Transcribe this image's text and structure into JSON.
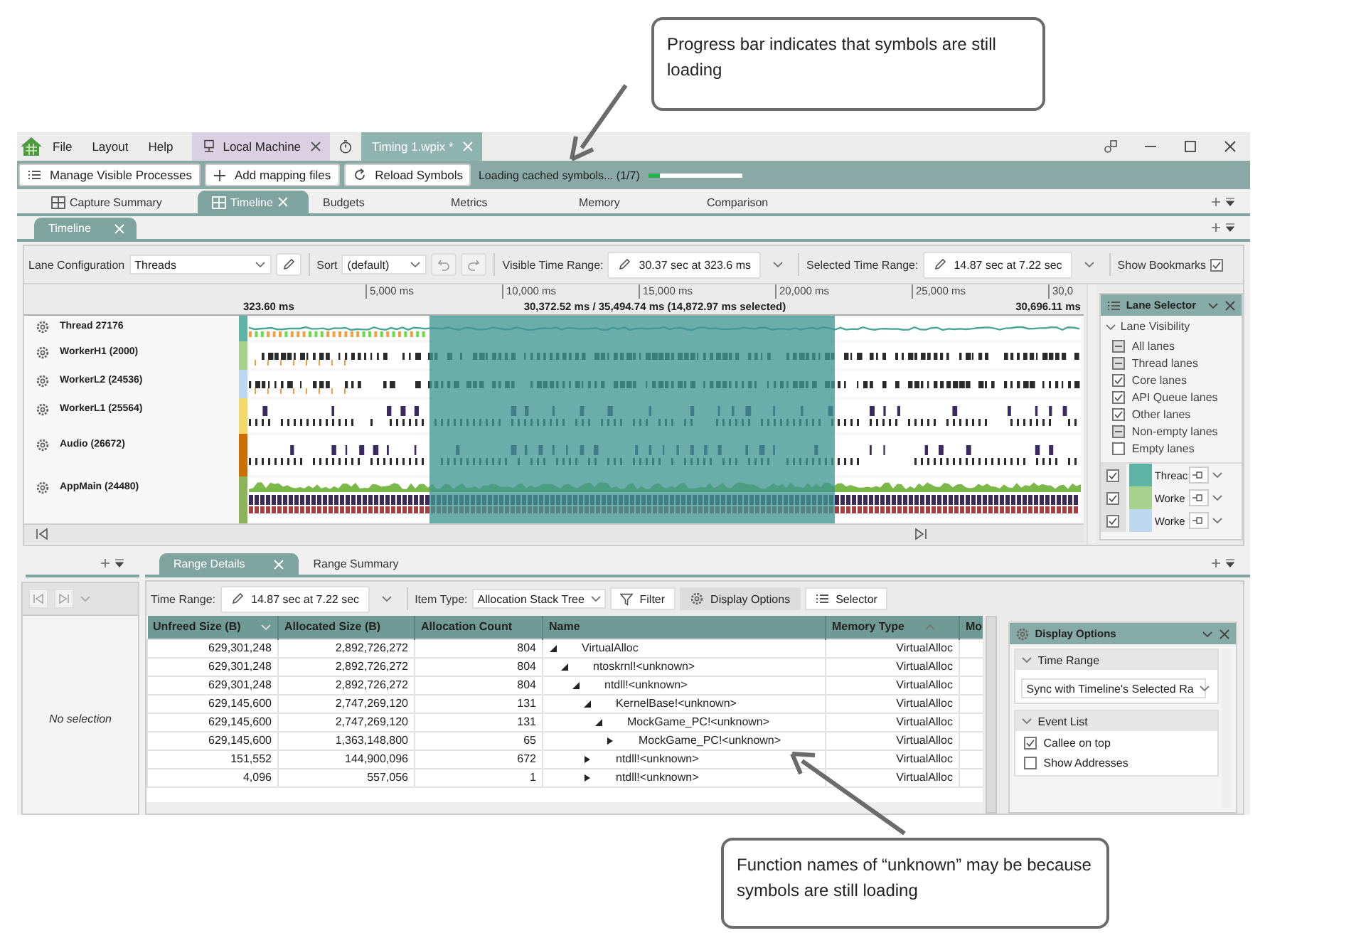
{
  "callouts": [
    {
      "text": "Progress bar indicates that symbols are still loading"
    },
    {
      "text": "Function names of “unknown” may be because symbols are still loading"
    }
  ],
  "menu": [
    "File",
    "Layout",
    "Help"
  ],
  "doc_tabs": [
    {
      "label": "Local Machine",
      "kind": "machine",
      "selected": false
    },
    {
      "label": "Timing 1.wpix *",
      "kind": "capture",
      "selected": true
    }
  ],
  "toolbar": {
    "buttons": [
      {
        "label": "Manage Visible Processes",
        "kind": "list"
      },
      {
        "label": "Add mapping files",
        "kind": "add"
      },
      {
        "label": "Reload Symbols",
        "kind": "reload"
      }
    ],
    "status": "Loading cached symbols... (1/7)",
    "progress": {
      "level": 0.12
    }
  },
  "view_tabs": [
    {
      "label": "Capture Summary",
      "kind": "grid",
      "selected": false
    },
    {
      "label": "Timeline",
      "kind": "grid",
      "selected": true
    },
    {
      "label": "Budgets",
      "kind": "plain",
      "selected": false
    },
    {
      "label": "Metrics",
      "kind": "plain",
      "selected": false
    },
    {
      "label": "Memory",
      "kind": "plain",
      "selected": false
    },
    {
      "label": "Comparison",
      "kind": "plain",
      "selected": false
    }
  ],
  "sub_tabs": [
    {
      "label": "Timeline",
      "selected": true
    }
  ],
  "timeline": {
    "toolbar": {
      "lane_config_label": "Lane Configuration",
      "lane_config": "Threads",
      "sort_label": "Sort",
      "sort": "(default)",
      "visible_label": "Visible Time Range:",
      "visible": "30.37 sec at 323.6 ms",
      "selected_label": "Selected Time Range:",
      "selected": "14.87 sec at 7.22 sec",
      "bookmarks_label": "Show Bookmarks",
      "bookmarks_checked": true
    },
    "ruler": {
      "ticks": [
        "5,000 ms",
        "10,000 ms",
        "15,000 ms",
        "20,000 ms",
        "25,000 ms",
        "30,0"
      ],
      "start": "323.60 ms",
      "center": "30,372.52 ms / 35,494.74 ms (14,872.97 ms selected)",
      "end": "30,696.11 ms"
    },
    "lanes": [
      {
        "name": "Thread 27176",
        "color": "#5fb3a5",
        "kind": "line"
      },
      {
        "name": "WorkerH1 (2000)",
        "color": "#a9d18e",
        "kind": "bars"
      },
      {
        "name": "WorkerL2 (24536)",
        "color": "#bdd7ee",
        "kind": "bars"
      },
      {
        "name": "WorkerL1 (25564)",
        "color": "#f2d96b",
        "kind": "double"
      },
      {
        "name": "Audio (26672)",
        "color": "#cc6e00",
        "kind": "double"
      },
      {
        "name": "AppMain (24480)",
        "color": "#8db35a",
        "kind": "stacked"
      }
    ],
    "lane_selector": {
      "title": "Lane Selector",
      "section": "Lane Visibility",
      "items": [
        {
          "label": "All lanes",
          "checked": false,
          "mixed": true
        },
        {
          "label": "Thread lanes",
          "checked": false,
          "mixed": true
        },
        {
          "label": "Core lanes",
          "checked": true,
          "mixed": false
        },
        {
          "label": "API Queue lanes",
          "checked": true,
          "mixed": false
        },
        {
          "label": "Other lanes",
          "checked": true,
          "mixed": false
        },
        {
          "label": "Non-empty lanes",
          "checked": false,
          "mixed": true
        },
        {
          "label": "Empty lanes",
          "checked": false,
          "mixed": false
        }
      ],
      "lanes": [
        {
          "label": "Threac",
          "color": "#5fb3a5",
          "checked": true
        },
        {
          "label": "Worke",
          "color": "#a9d18e",
          "checked": true
        },
        {
          "label": "Worke",
          "color": "#bdd7ee",
          "checked": true
        }
      ]
    }
  },
  "bottom": {
    "message": "No selection",
    "tabs": [
      {
        "label": "Range Details",
        "selected": true
      },
      {
        "label": "Range Summary",
        "selected": false
      }
    ],
    "toolbar": {
      "time_label": "Time Range:",
      "time": "14.87 sec at 7.22 sec",
      "type_label": "Item Type:",
      "type": "Allocation Stack Tree",
      "buttons": [
        {
          "label": "Filter",
          "kind": "filter",
          "selected": false
        },
        {
          "label": "Display Options",
          "kind": "gear",
          "selected": true
        },
        {
          "label": "Selector",
          "kind": "list",
          "selected": false
        }
      ]
    },
    "table": {
      "columns": [
        {
          "label": "Unfreed Size (B)",
          "sorted_descending": true,
          "sorted_ascending": false
        },
        {
          "label": "Allocated Size (B)",
          "sorted_descending": false,
          "sorted_ascending": false
        },
        {
          "label": "Allocation Count",
          "sorted_descending": false,
          "sorted_ascending": false
        },
        {
          "label": "Name",
          "sorted_descending": false,
          "sorted_ascending": false
        },
        {
          "label": "Memory Type",
          "sorted_descending": false,
          "sorted_ascending": true
        },
        {
          "label": "Mo"
        }
      ],
      "rows": [
        {
          "unfreed": "629,301,248",
          "allocated": "2,892,726,272",
          "count": "804",
          "name": "VirtualAlloc",
          "memory_type": "VirtualAlloc",
          "expanded": true,
          "children": [
            {
              "unfreed": "629,301,248",
              "allocated": "2,892,726,272",
              "count": "804",
              "name": "ntoskrnl!<unknown>",
              "memory_type": "VirtualAlloc",
              "expanded": true,
              "children": [
                {
                  "unfreed": "629,301,248",
                  "allocated": "2,892,726,272",
                  "count": "804",
                  "name": "ntdll!<unknown>",
                  "memory_type": "VirtualAlloc",
                  "expanded": true,
                  "children": [
                    {
                      "unfreed": "629,145,600",
                      "allocated": "2,747,269,120",
                      "count": "131",
                      "name": "KernelBase!<unknown>",
                      "memory_type": "VirtualAlloc",
                      "expanded": true,
                      "children": [
                        {
                          "unfreed": "629,145,600",
                          "allocated": "2,747,269,120",
                          "count": "131",
                          "name": "MockGame_PC!<unknown>",
                          "memory_type": "VirtualAlloc",
                          "expanded": true,
                          "children": [
                            {
                              "unfreed": "629,145,600",
                              "allocated": "1,363,148,800",
                              "count": "65",
                              "name": "MockGame_PC!<unknown>",
                              "memory_type": "VirtualAlloc",
                              "expanded": false
                            }
                          ]
                        }
                      ]
                    },
                    {
                      "unfreed": "151,552",
                      "allocated": "144,900,096",
                      "count": "672",
                      "name": "ntdll!<unknown>",
                      "memory_type": "VirtualAlloc",
                      "expanded": false
                    },
                    {
                      "unfreed": "4,096",
                      "allocated": "557,056",
                      "count": "1",
                      "name": "ntdll!<unknown>",
                      "memory_type": "VirtualAlloc",
                      "expanded": false
                    }
                  ]
                }
              ]
            }
          ]
        }
      ]
    },
    "display_options": {
      "title": "Display Options",
      "sections": [
        {
          "title": "Time Range",
          "kind": "dropdown",
          "value": "Sync with Timeline's Selected Ra"
        },
        {
          "title": "Event List",
          "kind": "checks",
          "items": [
            {
              "label": "Callee on top",
              "checked": true
            },
            {
              "label": "Show Addresses",
              "checked": false
            }
          ]
        }
      ]
    }
  }
}
